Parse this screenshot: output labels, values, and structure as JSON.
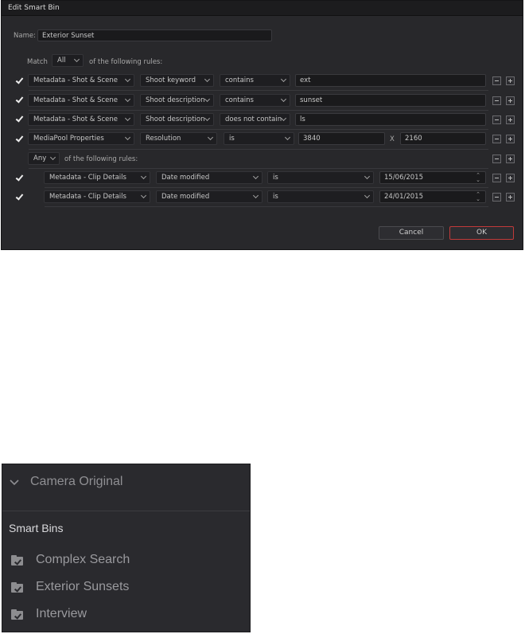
{
  "dialog": {
    "title": "Edit Smart Bin",
    "name_label": "Name:",
    "name_value": "Exterior Sunset",
    "match_label": "Match",
    "match_value": "All",
    "match_suffix": "of the following rules:",
    "rules": [
      {
        "category": "Metadata - Shot & Scene",
        "field": "Shoot keyword",
        "operator": "contains",
        "value": "ext"
      },
      {
        "category": "Metadata - Shot & Scene",
        "field": "Shoot description",
        "operator": "contains",
        "value": "sunset"
      },
      {
        "category": "Metadata - Shot & Scene",
        "field": "Shoot description",
        "operator": "does not contain",
        "value": "ls"
      },
      {
        "category": "MediaPool Properties",
        "field": "Resolution",
        "operator": "is",
        "value": "3840",
        "x_label": "X",
        "value2": "2160"
      }
    ],
    "subgroup": {
      "match_value": "Any",
      "match_suffix": "of the following rules:",
      "rules": [
        {
          "category": "Metadata - Clip Details",
          "field": "Date modified",
          "operator": "is",
          "value": "15/06/2015"
        },
        {
          "category": "Metadata - Clip Details",
          "field": "Date modified",
          "operator": "is",
          "value": "24/01/2015"
        }
      ]
    },
    "cancel_label": "Cancel",
    "ok_label": "OK"
  },
  "panel": {
    "camera_original": "Camera Original",
    "smart_bins_heading": "Smart Bins",
    "bins": [
      "Complex Search",
      "Exterior Sunsets",
      "Interview"
    ]
  },
  "colors": {
    "dialog_bg": "#28282b",
    "ok_border": "#c23a3a",
    "panel_bg": "#2a2a2e"
  }
}
